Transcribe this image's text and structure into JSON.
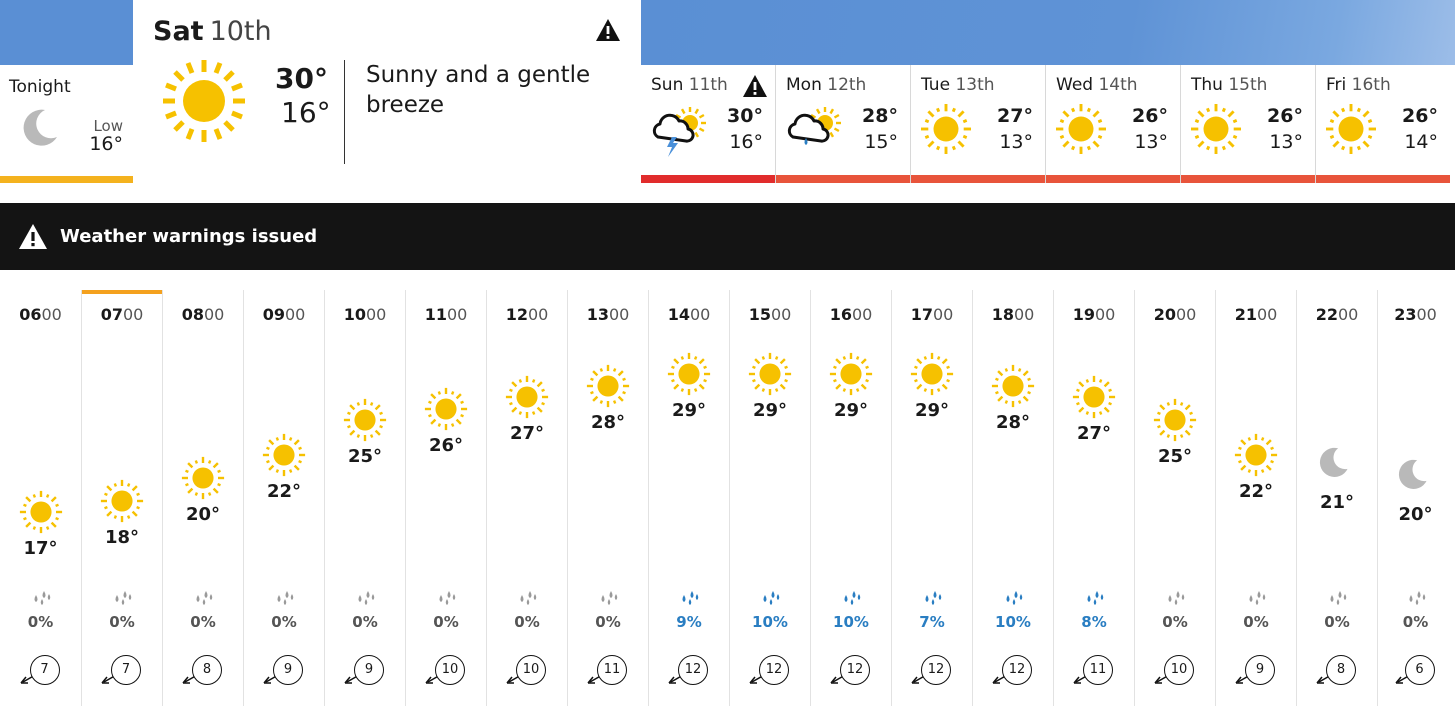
{
  "tonight": {
    "label": "Tonight",
    "low_label": "Low",
    "low": "16°",
    "icon": "moon-icon"
  },
  "today": {
    "day": "Sat",
    "date": "10th",
    "high": "30°",
    "low": "16°",
    "description": "Sunny and a gentle breeze",
    "icon": "sun-icon",
    "has_warning": true
  },
  "days": [
    {
      "day": "Sun",
      "date": "11th",
      "high": "30°",
      "low": "16°",
      "icon": "thunder-sun-icon",
      "warning": true,
      "bar_color": "#e12c2c"
    },
    {
      "day": "Mon",
      "date": "12th",
      "high": "28°",
      "low": "15°",
      "icon": "light-rain-sun-icon",
      "warning": false,
      "bar_color": "#e8543b"
    },
    {
      "day": "Tue",
      "date": "13th",
      "high": "27°",
      "low": "13°",
      "icon": "sun-icon",
      "warning": false,
      "bar_color": "#e8543b"
    },
    {
      "day": "Wed",
      "date": "14th",
      "high": "26°",
      "low": "13°",
      "icon": "sun-icon",
      "warning": false,
      "bar_color": "#e8543b"
    },
    {
      "day": "Thu",
      "date": "15th",
      "high": "26°",
      "low": "13°",
      "icon": "sun-icon",
      "warning": false,
      "bar_color": "#e8543b"
    },
    {
      "day": "Fri",
      "date": "16th",
      "high": "26°",
      "low": "14°",
      "icon": "sun-icon",
      "warning": false,
      "bar_color": "#e8543b"
    }
  ],
  "banner": {
    "text": "Weather warnings issued"
  },
  "hours": [
    {
      "hh": "06",
      "mm": "00",
      "temp": 17,
      "temp_label": "17°",
      "icon": "sun-icon",
      "rain": "0%",
      "wet": false,
      "wind": "7"
    },
    {
      "hh": "07",
      "mm": "00",
      "temp": 18,
      "temp_label": "18°",
      "icon": "sun-icon",
      "rain": "0%",
      "wet": false,
      "wind": "7",
      "current": true
    },
    {
      "hh": "08",
      "mm": "00",
      "temp": 20,
      "temp_label": "20°",
      "icon": "sun-icon",
      "rain": "0%",
      "wet": false,
      "wind": "8"
    },
    {
      "hh": "09",
      "mm": "00",
      "temp": 22,
      "temp_label": "22°",
      "icon": "sun-icon",
      "rain": "0%",
      "wet": false,
      "wind": "9"
    },
    {
      "hh": "10",
      "mm": "00",
      "temp": 25,
      "temp_label": "25°",
      "icon": "sun-icon",
      "rain": "0%",
      "wet": false,
      "wind": "9"
    },
    {
      "hh": "11",
      "mm": "00",
      "temp": 26,
      "temp_label": "26°",
      "icon": "sun-icon",
      "rain": "0%",
      "wet": false,
      "wind": "10"
    },
    {
      "hh": "12",
      "mm": "00",
      "temp": 27,
      "temp_label": "27°",
      "icon": "sun-icon",
      "rain": "0%",
      "wet": false,
      "wind": "10"
    },
    {
      "hh": "13",
      "mm": "00",
      "temp": 28,
      "temp_label": "28°",
      "icon": "sun-icon",
      "rain": "0%",
      "wet": false,
      "wind": "11"
    },
    {
      "hh": "14",
      "mm": "00",
      "temp": 29,
      "temp_label": "29°",
      "icon": "sun-icon",
      "rain": "9%",
      "wet": true,
      "wind": "12"
    },
    {
      "hh": "15",
      "mm": "00",
      "temp": 29,
      "temp_label": "29°",
      "icon": "sun-icon",
      "rain": "10%",
      "wet": true,
      "wind": "12"
    },
    {
      "hh": "16",
      "mm": "00",
      "temp": 29,
      "temp_label": "29°",
      "icon": "sun-icon",
      "rain": "10%",
      "wet": true,
      "wind": "12"
    },
    {
      "hh": "17",
      "mm": "00",
      "temp": 29,
      "temp_label": "29°",
      "icon": "sun-icon",
      "rain": "7%",
      "wet": true,
      "wind": "12"
    },
    {
      "hh": "18",
      "mm": "00",
      "temp": 28,
      "temp_label": "28°",
      "icon": "sun-icon",
      "rain": "10%",
      "wet": true,
      "wind": "12"
    },
    {
      "hh": "19",
      "mm": "00",
      "temp": 27,
      "temp_label": "27°",
      "icon": "sun-icon",
      "rain": "8%",
      "wet": true,
      "wind": "11"
    },
    {
      "hh": "20",
      "mm": "00",
      "temp": 25,
      "temp_label": "25°",
      "icon": "sun-icon",
      "rain": "0%",
      "wet": false,
      "wind": "10"
    },
    {
      "hh": "21",
      "mm": "00",
      "temp": 22,
      "temp_label": "22°",
      "icon": "sun-icon",
      "rain": "0%",
      "wet": false,
      "wind": "9"
    },
    {
      "hh": "22",
      "mm": "00",
      "temp": 21,
      "temp_label": "21°",
      "icon": "moon-icon",
      "rain": "0%",
      "wet": false,
      "wind": "8"
    },
    {
      "hh": "23",
      "mm": "00",
      "temp": 20,
      "temp_label": "20°",
      "icon": "moon-icon",
      "rain": "0%",
      "wet": false,
      "wind": "6"
    }
  ],
  "colors": {
    "sun": "#f6c100",
    "moon": "#b9b9b9",
    "current_hour": "#f4a11e",
    "tonight_bar": "#f4b21e",
    "rain_wet": "#2a7ec2",
    "rain_dry": "#9a9a9a"
  }
}
